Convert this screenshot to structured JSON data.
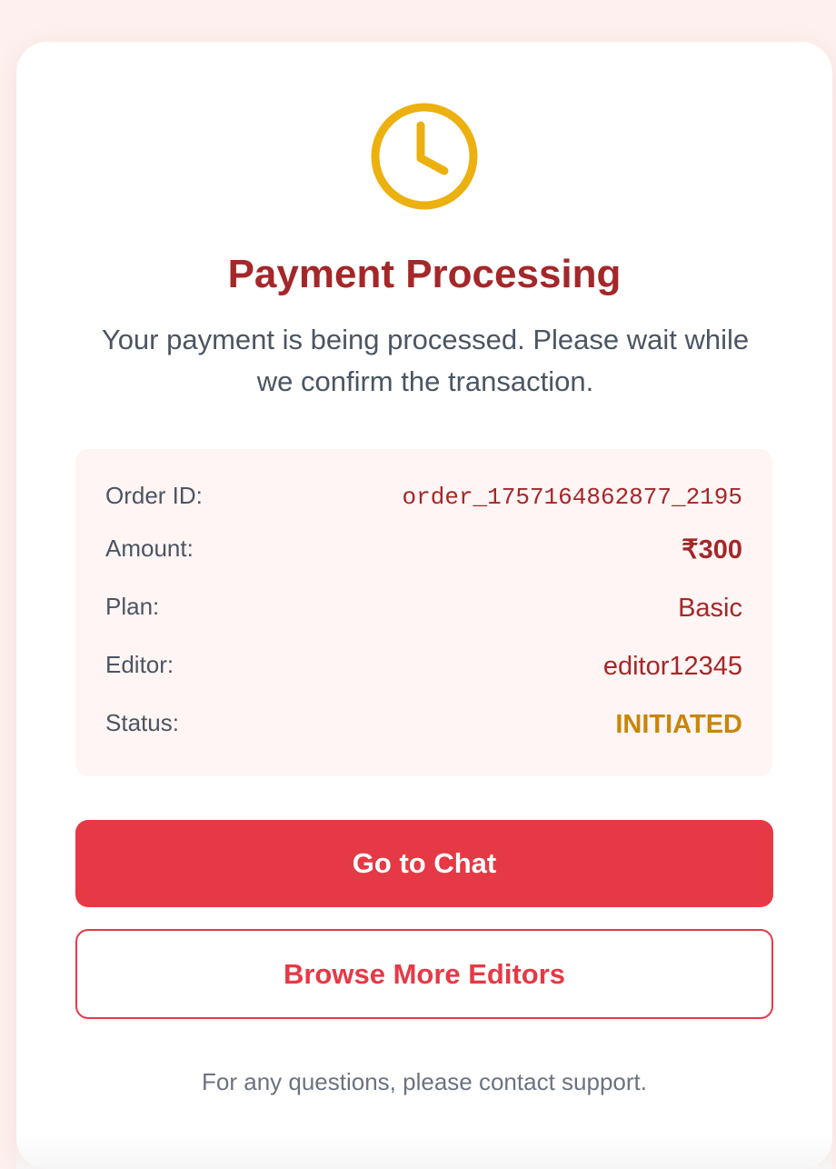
{
  "colors": {
    "page_background": "#fdf0ee",
    "accent": "#e63946",
    "title": "#a42729",
    "pending_icon": "#ecb00f",
    "status_pending": "#c8860a",
    "details_background": "#fff5f4"
  },
  "status_icon": "clock-icon",
  "title": "Payment Processing",
  "description": "Your payment is being processed. Please wait while we confirm the transaction.",
  "details": {
    "order_id": {
      "label": "Order ID:",
      "value": "order_1757164862877_2195"
    },
    "amount": {
      "label": "Amount:",
      "value": "₹300"
    },
    "plan": {
      "label": "Plan:",
      "value": "Basic"
    },
    "editor": {
      "label": "Editor:",
      "value": "editor12345"
    },
    "status": {
      "label": "Status:",
      "value": "INITIATED"
    }
  },
  "buttons": {
    "primary": "Go to Chat",
    "secondary": "Browse More Editors"
  },
  "footer": "For any questions, please contact support."
}
